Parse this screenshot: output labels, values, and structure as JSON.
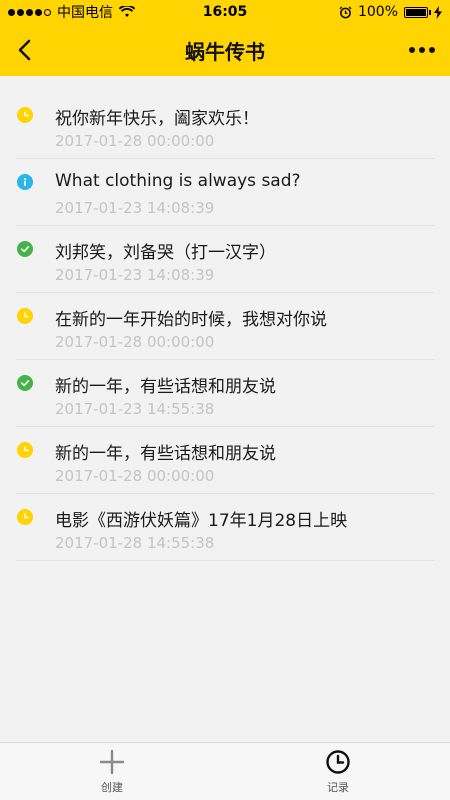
{
  "status_bar": {
    "carrier": "中国电信",
    "time": "16:05",
    "battery": "100%"
  },
  "nav": {
    "title": "蜗牛传书",
    "back_icon": "chevron-left-icon",
    "more_icon": "more-dots-icon"
  },
  "colors": {
    "brand": "#ffd400",
    "pending": "#ffd400",
    "info": "#29b6e8",
    "done": "#43b34a"
  },
  "items": [
    {
      "status": "pending",
      "title": "祝你新年快乐，阖家欢乐！",
      "date": "2017-01-28 00:00:00"
    },
    {
      "status": "info",
      "title": "What clothing is always sad?",
      "date": "2017-01-23 14:08:39"
    },
    {
      "status": "done",
      "title": "刘邦笑，刘备哭（打一汉字）",
      "date": "2017-01-23 14:08:39"
    },
    {
      "status": "pending",
      "title": "在新的一年开始的时候，我想对你说",
      "date": "2017-01-28 00:00:00"
    },
    {
      "status": "done",
      "title": "新的一年，有些话想和朋友说",
      "date": "2017-01-23 14:55:38"
    },
    {
      "status": "pending",
      "title": "新的一年，有些话想和朋友说",
      "date": "2017-01-28 00:00:00"
    },
    {
      "status": "pending",
      "title": "电影《西游伏妖篇》17年1月28日上映",
      "date": "2017-01-28 14:55:38"
    }
  ],
  "tabs": {
    "create": {
      "label": "创建",
      "icon": "plus-icon"
    },
    "records": {
      "label": "记录",
      "icon": "clock-icon"
    }
  }
}
